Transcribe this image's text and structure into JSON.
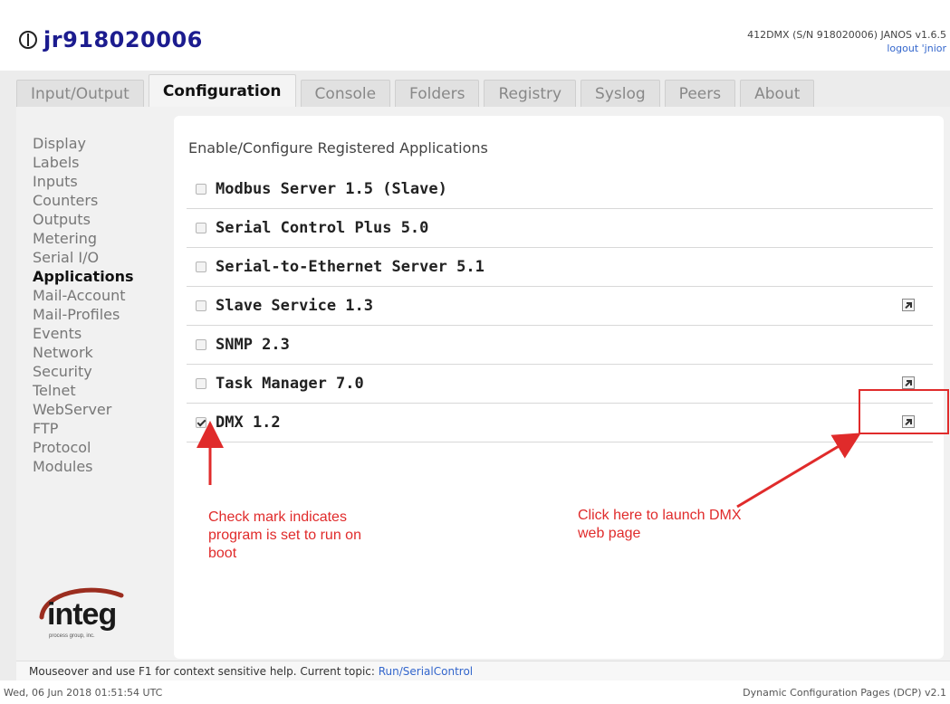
{
  "header": {
    "hostname": "jr918020006",
    "system_info": "412DMX (S/N 918020006) JANOS v1.6.5",
    "logout_label": "logout 'jnior"
  },
  "tabs": [
    {
      "label": "Input/Output",
      "active": false
    },
    {
      "label": "Configuration",
      "active": true
    },
    {
      "label": "Console",
      "active": false
    },
    {
      "label": "Folders",
      "active": false
    },
    {
      "label": "Registry",
      "active": false
    },
    {
      "label": "Syslog",
      "active": false
    },
    {
      "label": "Peers",
      "active": false
    },
    {
      "label": "About",
      "active": false
    }
  ],
  "sidebar": {
    "items": [
      {
        "label": "Display"
      },
      {
        "label": "Labels"
      },
      {
        "label": "Inputs"
      },
      {
        "label": "Counters"
      },
      {
        "label": "Outputs"
      },
      {
        "label": "Metering"
      },
      {
        "label": "Serial I/O"
      },
      {
        "label": "Applications",
        "active": true
      },
      {
        "label": "Mail-Account"
      },
      {
        "label": "Mail-Profiles"
      },
      {
        "label": "Events"
      },
      {
        "label": "Network"
      },
      {
        "label": "Security"
      },
      {
        "label": "Telnet"
      },
      {
        "label": "WebServer"
      },
      {
        "label": "FTP"
      },
      {
        "label": "Protocol"
      },
      {
        "label": "Modules"
      }
    ]
  },
  "logo": {
    "text": "integ",
    "tagline": "process group, inc."
  },
  "main": {
    "title": "Enable/Configure Registered Applications",
    "apps": [
      {
        "name": "Modbus Server 1.5 (Slave)",
        "checked": false,
        "launch": false
      },
      {
        "name": "Serial Control Plus 5.0",
        "checked": false,
        "launch": false
      },
      {
        "name": "Serial-to-Ethernet Server 5.1",
        "checked": false,
        "launch": false
      },
      {
        "name": "Slave Service 1.3",
        "checked": false,
        "launch": true
      },
      {
        "name": "SNMP 2.3",
        "checked": false,
        "launch": false
      },
      {
        "name": "Task Manager 7.0",
        "checked": false,
        "launch": true
      },
      {
        "name": "DMX 1.2",
        "checked": true,
        "launch": true
      }
    ]
  },
  "annotations": {
    "checkmark_note": "Check mark indicates program is set to run on boot",
    "launch_note": "Click here to launch DMX web page",
    "color": "#e02b2b"
  },
  "status": {
    "help_text": "Mouseover and use F1 for context sensitive help. Current topic: ",
    "topic": "Run/SerialControl"
  },
  "footer": {
    "datetime": "Wed, 06 Jun 2018 01:51:54 UTC",
    "version": "Dynamic Configuration Pages (DCP) v2.1"
  }
}
